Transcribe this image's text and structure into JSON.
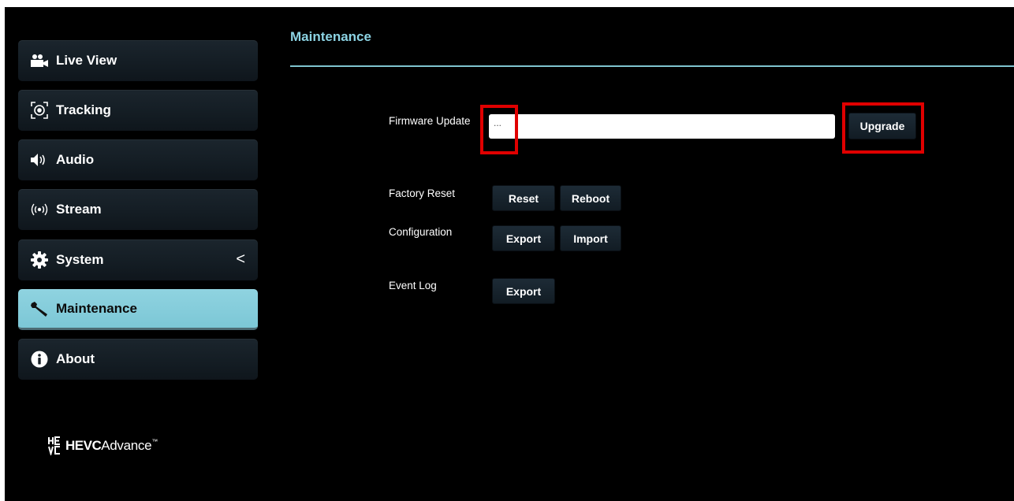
{
  "sidebar": {
    "items": [
      {
        "label": "Live View",
        "icon": "video-camera-icon"
      },
      {
        "label": "Tracking",
        "icon": "tracking-target-icon"
      },
      {
        "label": "Audio",
        "icon": "speaker-icon"
      },
      {
        "label": "Stream",
        "icon": "broadcast-icon"
      },
      {
        "label": "System",
        "icon": "gear-icon",
        "expand": "<"
      },
      {
        "label": "Maintenance",
        "icon": "wrench-icon",
        "active": true
      },
      {
        "label": "About",
        "icon": "info-icon"
      }
    ]
  },
  "brand": {
    "hev": "HEVC",
    "adv": "Advance",
    "tm": "™"
  },
  "main": {
    "title": "Maintenance",
    "firmware": {
      "label": "Firmware Update",
      "input_value": "...",
      "upgrade_label": "Upgrade"
    },
    "factory_reset": {
      "label": "Factory Reset",
      "reset_label": "Reset",
      "reboot_label": "Reboot"
    },
    "configuration": {
      "label": "Configuration",
      "export_label": "Export",
      "import_label": "Import"
    },
    "event_log": {
      "label": "Event Log",
      "export_label": "Export"
    }
  },
  "colors": {
    "accent": "#8cd3e3",
    "active_nav": "#85cdda",
    "highlight": "#e00000",
    "background": "#000000"
  }
}
